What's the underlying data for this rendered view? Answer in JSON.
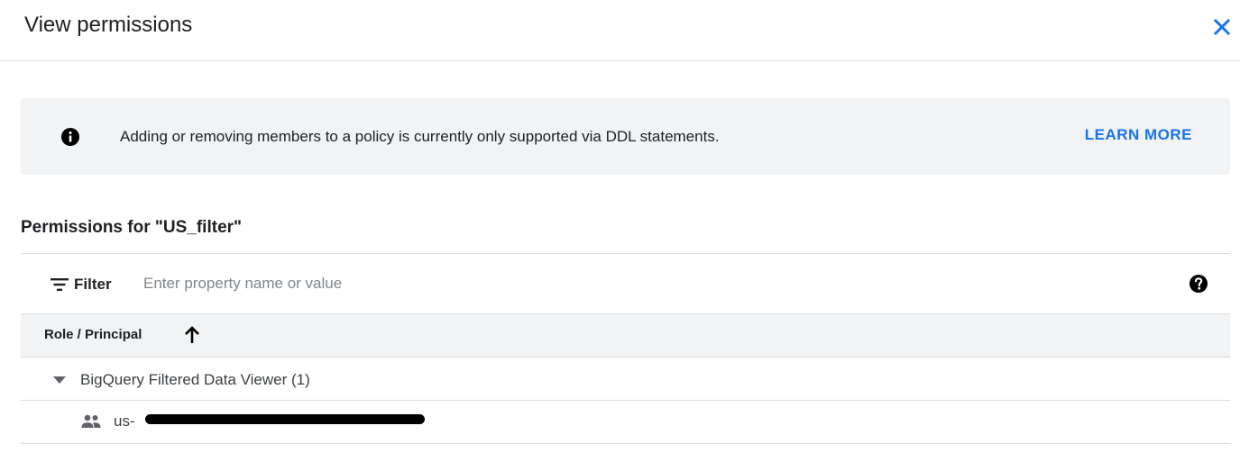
{
  "dialog": {
    "title": "View permissions",
    "close_icon": "close-icon"
  },
  "banner": {
    "icon": "info-icon",
    "message": "Adding or removing members to a policy is currently only supported via DDL statements.",
    "link_label": "LEARN MORE",
    "link_color": "#1a73e8"
  },
  "permissions": {
    "title": "Permissions for \"US_filter\"",
    "filter": {
      "icon": "filter-icon",
      "label": "Filter",
      "placeholder": "Enter property name or value",
      "value": "",
      "help_icon": "help-icon"
    },
    "columns": [
      {
        "label": "Role / Principal",
        "sort": "ascending",
        "sort_icon": "arrow-up-icon"
      }
    ],
    "groups": [
      {
        "label": "BigQuery Filtered Data Viewer (1)",
        "expanded": true,
        "expand_icon": "triangle-down-icon",
        "members": [
          {
            "icon": "group-icon",
            "label": "us-",
            "redacted": true
          }
        ]
      }
    ]
  }
}
